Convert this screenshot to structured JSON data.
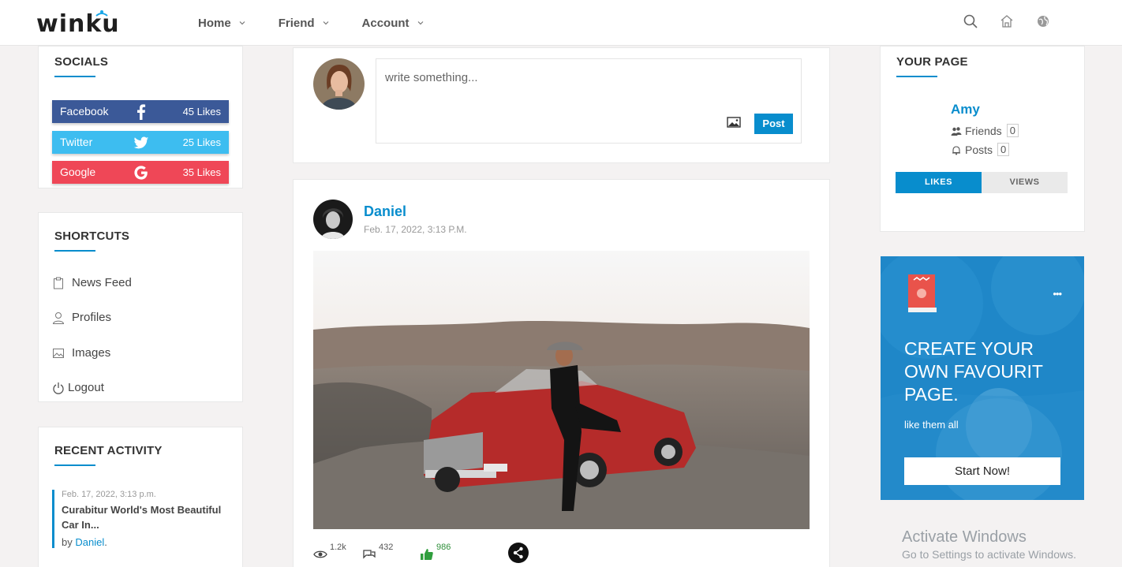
{
  "brand": {
    "logo_text": "winku"
  },
  "nav": {
    "items": [
      {
        "label": "Home"
      },
      {
        "label": "Friend"
      },
      {
        "label": "Account"
      }
    ]
  },
  "socials": {
    "title": "SOCIALS",
    "items": [
      {
        "name": "Facebook",
        "likes": "45 Likes",
        "color": "#3b5998",
        "icon": "facebook-icon"
      },
      {
        "name": "Twitter",
        "likes": "25 Likes",
        "color": "#3dbdf0",
        "icon": "twitter-icon"
      },
      {
        "name": "Google",
        "likes": "35 Likes",
        "color": "#ef4757",
        "icon": "google-icon"
      }
    ]
  },
  "shortcuts": {
    "title": "SHORTCUTS",
    "items": [
      {
        "label": "News Feed",
        "icon": "clipboard-icon"
      },
      {
        "label": "Profiles",
        "icon": "user-icon"
      },
      {
        "label": "Images",
        "icon": "image-icon"
      },
      {
        "label": "Logout",
        "icon": "power-icon"
      }
    ]
  },
  "recent_activity": {
    "title": "RECENT ACTIVITY",
    "item": {
      "date": "Feb. 17, 2022, 3:13 p.m.",
      "title_line1": "Curabitur World's Most Beautiful",
      "title_line2": "Car In...",
      "by_prefix": "by",
      "author": "Daniel",
      "suffix": "."
    }
  },
  "composer": {
    "placeholder": "write something...",
    "post_label": "Post"
  },
  "post": {
    "author": "Daniel",
    "date": "Feb. 17, 2022, 3:13 P.M.",
    "views": "1.2k",
    "comments": "432",
    "likes": "986"
  },
  "your_page": {
    "title": "YOUR PAGE",
    "name": "Amy",
    "friends_label": "Friends",
    "friends_count": "0",
    "posts_label": "Posts",
    "posts_count": "0",
    "tabs": [
      {
        "label": "LIKES"
      },
      {
        "label": "VIEWS"
      }
    ]
  },
  "promo": {
    "title_line1": "CREATE YOUR",
    "title_line2": "OWN FAVOURIT",
    "title_line3": "PAGE.",
    "subtitle": "like them all",
    "button": "Start Now!",
    "dots": "•••"
  },
  "watermark": {
    "line1": "Activate Windows",
    "line2": "Go to Settings to activate Windows."
  },
  "colors": {
    "accent": "#088dcd",
    "background": "#f4f2f2"
  }
}
